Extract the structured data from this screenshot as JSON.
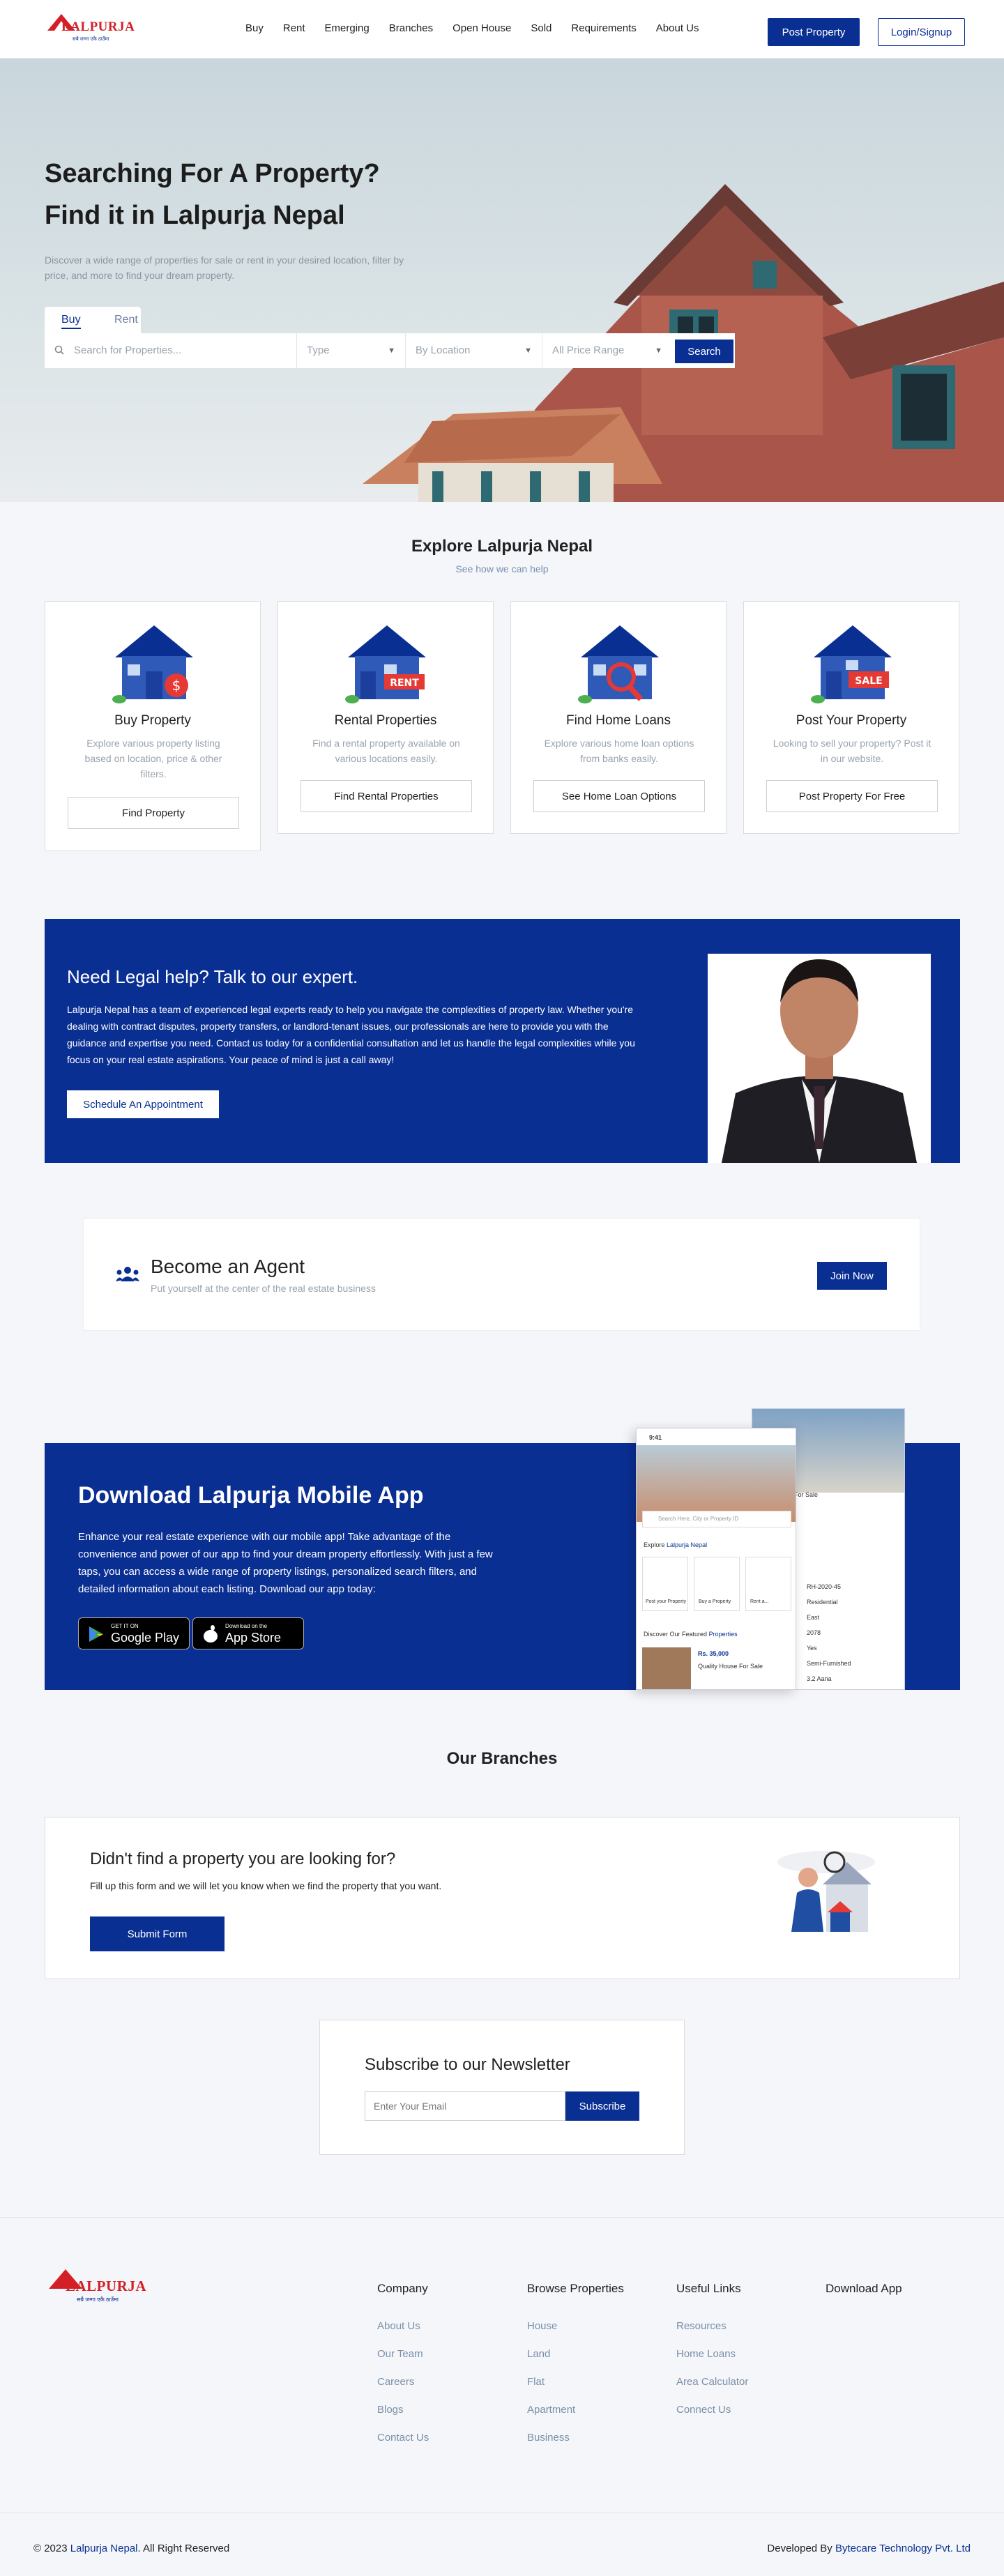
{
  "header": {
    "logo_text": "LALPURJA",
    "logo_tagline": "सबै जग्गा एकै ठाउँमा",
    "nav": [
      "Buy",
      "Rent",
      "Emerging",
      "Branches",
      "Open House",
      "Sold",
      "Requirements",
      "About Us"
    ],
    "post_property": "Post Property",
    "login": "Login/Signup"
  },
  "hero": {
    "title_line1": "Searching For A Property?",
    "title_line2": "Find it in Lalpurja Nepal",
    "description": "Discover a wide range of properties for sale or rent in your desired location, filter by price, and more to find your dream property.",
    "tabs": [
      "Buy",
      "Rent"
    ],
    "search_placeholder": "Search for Properties...",
    "type": "Type",
    "location": "By Location",
    "price": "All Price Range",
    "search_button": "Search"
  },
  "explore": {
    "title": "Explore Lalpurja Nepal",
    "subtitle": "See how we can help",
    "cards": [
      {
        "title": "Buy Property",
        "text": "Explore various property listing based on location, price & other filters.",
        "button": "Find Property",
        "icon": "buy-house-icon"
      },
      {
        "title": "Rental Properties",
        "text": "Find a rental property available on various locations easily.",
        "button": "Find Rental Properties",
        "icon": "rent-house-icon"
      },
      {
        "title": "Find Home Loans",
        "text": "Explore various home loan options from banks easily.",
        "button": "See Home Loan Options",
        "icon": "loan-house-icon"
      },
      {
        "title": "Post Your Property",
        "text": "Looking to sell your property? Post it in our website.",
        "button": "Post Property For Free",
        "icon": "sale-house-icon"
      }
    ]
  },
  "legal": {
    "title": "Need Legal help? Talk to our expert.",
    "text": "Lalpurja Nepal has a team of experienced legal experts ready to help you navigate the complexities of property law. Whether you're dealing with contract disputes, property transfers, or landlord-tenant issues, our professionals are here to provide you with the guidance and expertise you need. Contact us today for a confidential consultation and let us handle the legal complexities while you focus on your real estate aspirations. Your peace of mind is just a call away!",
    "button": "Schedule An Appointment"
  },
  "agent": {
    "title": "Become an Agent",
    "subtitle": "Put yourself at the center of the real estate business",
    "button": "Join Now"
  },
  "app": {
    "title": "Download Lalpurja Mobile App",
    "text": "Enhance your real estate experience with our mobile app! Take advantage of the convenience and power of our app to find your dream property effortlessly. With just a few taps, you can access a wide range of property listings, personalized search filters, and detailed information about each listing. Download our app today:",
    "google_small": "GET IT ON",
    "google_big": "Google Play",
    "apple_small": "Download on the",
    "apple_big": "App Store",
    "phone": {
      "time": "9:41",
      "search": "Search Here, City or Property ID",
      "explore": "Explore",
      "explore_brand": "Lalpurja Nepal",
      "post": "Post your Property",
      "buy": "Buy a Property",
      "rent": "Rent a...",
      "featured": "Discover Our Featured",
      "featured_accent": "Properties",
      "price": "Rs. 35,000",
      "listing": "Quality House For Sale",
      "details": [
        "For Sale",
        "RH-2020-45",
        "Residential",
        "East",
        "2078",
        "Yes",
        "Semi-Furnished",
        "3.2 Aana"
      ]
    }
  },
  "branches": {
    "title": "Our Branches",
    "form_title": "Didn't find a property you are looking for?",
    "form_text": "Fill up this form and we will let you know when we find the property that you want.",
    "form_button": "Submit Form"
  },
  "newsletter": {
    "title": "Subscribe to our Newsletter",
    "placeholder": "Enter Your Email",
    "button": "Subscribe"
  },
  "footer": {
    "columns": [
      {
        "title": "Company",
        "links": [
          "About Us",
          "Our Team",
          "Careers",
          "Blogs",
          "Contact Us"
        ]
      },
      {
        "title": "Browse Properties",
        "links": [
          "House",
          "Land",
          "Flat",
          "Apartment",
          "Business"
        ]
      },
      {
        "title": "Useful Links",
        "links": [
          "Resources",
          "Home Loans",
          "Area Calculator",
          "Connect Us"
        ]
      },
      {
        "title": "Download App",
        "links": []
      }
    ],
    "copyright_prefix": "© 2023",
    "copyright_brand": "Lalpurja Nepal",
    "copyright_suffix": ". All Right Reserved",
    "developed_prefix": "Developed By",
    "developed_by": "Bytecare Technology Pvt. Ltd"
  },
  "colors": {
    "primary": "#0a2f93",
    "brand_red": "#d32027"
  }
}
